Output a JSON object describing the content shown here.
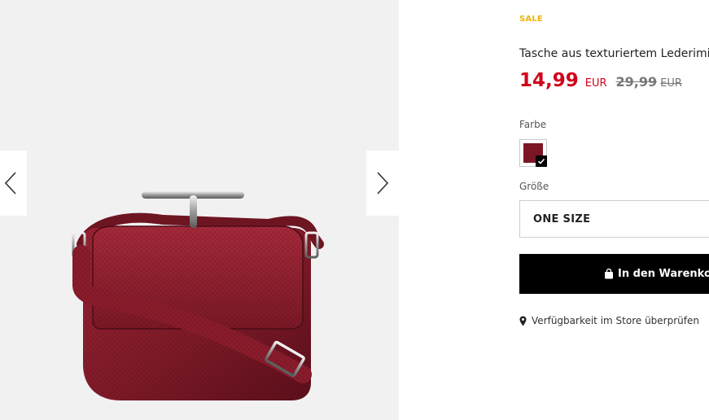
{
  "gallery": {
    "image_alt": "Tasche aus texturiertem Lederimitat",
    "prev_icon": "chevron-left-icon",
    "next_icon": "chevron-right-icon"
  },
  "product": {
    "sale_label": "SALE",
    "title": "Tasche aus texturiertem Lederimitat",
    "price": "14,99",
    "currency": "EUR",
    "old_price": "29,99",
    "old_currency": "EUR"
  },
  "options": {
    "color_label": "Farbe",
    "selected_color": "#7b1624",
    "size_label": "Größe",
    "size_value": "ONE SIZE"
  },
  "actions": {
    "cart_label": "In den Warenkorb",
    "cart_icon": "shopping-bag-icon",
    "store_label": "Verfügbarkeit im Store überprüfen",
    "store_icon": "map-pin-icon"
  },
  "colors": {
    "sale": "#f0b400",
    "price": "#d0021b",
    "button": "#000000"
  }
}
